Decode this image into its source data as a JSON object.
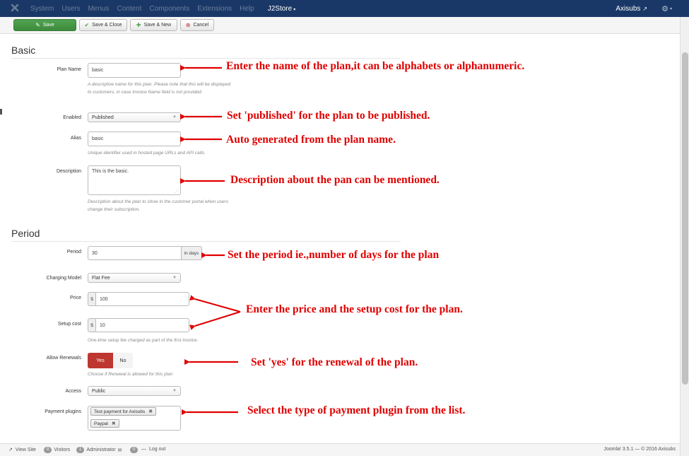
{
  "navbar": {
    "menu": [
      "System",
      "Users",
      "Menus",
      "Content",
      "Components",
      "Extensions",
      "Help"
    ],
    "active_menu": "J2Store",
    "site_name": "Axisubs"
  },
  "toolbar": {
    "save_label": "Save",
    "save_close_label": "Save & Close",
    "save_new_label": "Save & New",
    "cancel_label": "Cancel"
  },
  "basic": {
    "title": "Basic",
    "plan_name": {
      "label": "Plan Name",
      "value": "basic",
      "help": "A descriptive name for this plan. Please note that this will be displayed to customers, in case Invoice Name field is not provided."
    },
    "enabled": {
      "label": "Enabled",
      "value": "Published"
    },
    "alias": {
      "label": "Alias",
      "value": "basic",
      "help": "Unique identifier used in hosted page URLs and API calls."
    },
    "description": {
      "label": "Description",
      "value": "This is the basic.",
      "help": "Description about the plan to show in the customer portal when users change their subscription."
    }
  },
  "period": {
    "title": "Period",
    "period": {
      "label": "Period",
      "value": "30",
      "addon": "in days"
    },
    "charging_model": {
      "label": "Charging Model",
      "value": "Flat Fee"
    },
    "price": {
      "label": "Price",
      "currency": "$",
      "value": "100"
    },
    "setup_cost": {
      "label": "Setup cost",
      "currency": "$",
      "value": "10",
      "help": "One-time setup fee charged as part of the first invoice."
    },
    "allow_renewals": {
      "label": "Allow Renewals",
      "yes": "Yes",
      "no": "No",
      "help": "Choose if Renewal is allowed for this plan"
    },
    "access": {
      "label": "Access",
      "value": "Public"
    },
    "payment_plugins": {
      "label": "Payment plugins",
      "items": [
        "Test payment for Axisubs",
        "Paypal"
      ]
    }
  },
  "annotations": {
    "plan_name": "Enter the name of the plan,it can be alphabets or alphanumeric.",
    "enabled": "Set 'published' for the plan to be published.",
    "alias": "Auto generated from the plan name.",
    "description": "Description about the pan can be mentioned.",
    "period": "Set the period ie.,number of days for the plan",
    "price": "Enter the price and the setup cost for the plan.",
    "renewals": "Set 'yes' for the renewal of the plan.",
    "payment": "Select the type of payment plugin from the list."
  },
  "statusbar": {
    "view_site": "View Site",
    "visitors_count": "0",
    "visitors": "Visitors",
    "admin_count": "1",
    "administrator": "Administrator",
    "messages_count": "0",
    "logout": "Log out",
    "version": "Joomla! 3.5.1 — © 2016 Axisubs"
  }
}
